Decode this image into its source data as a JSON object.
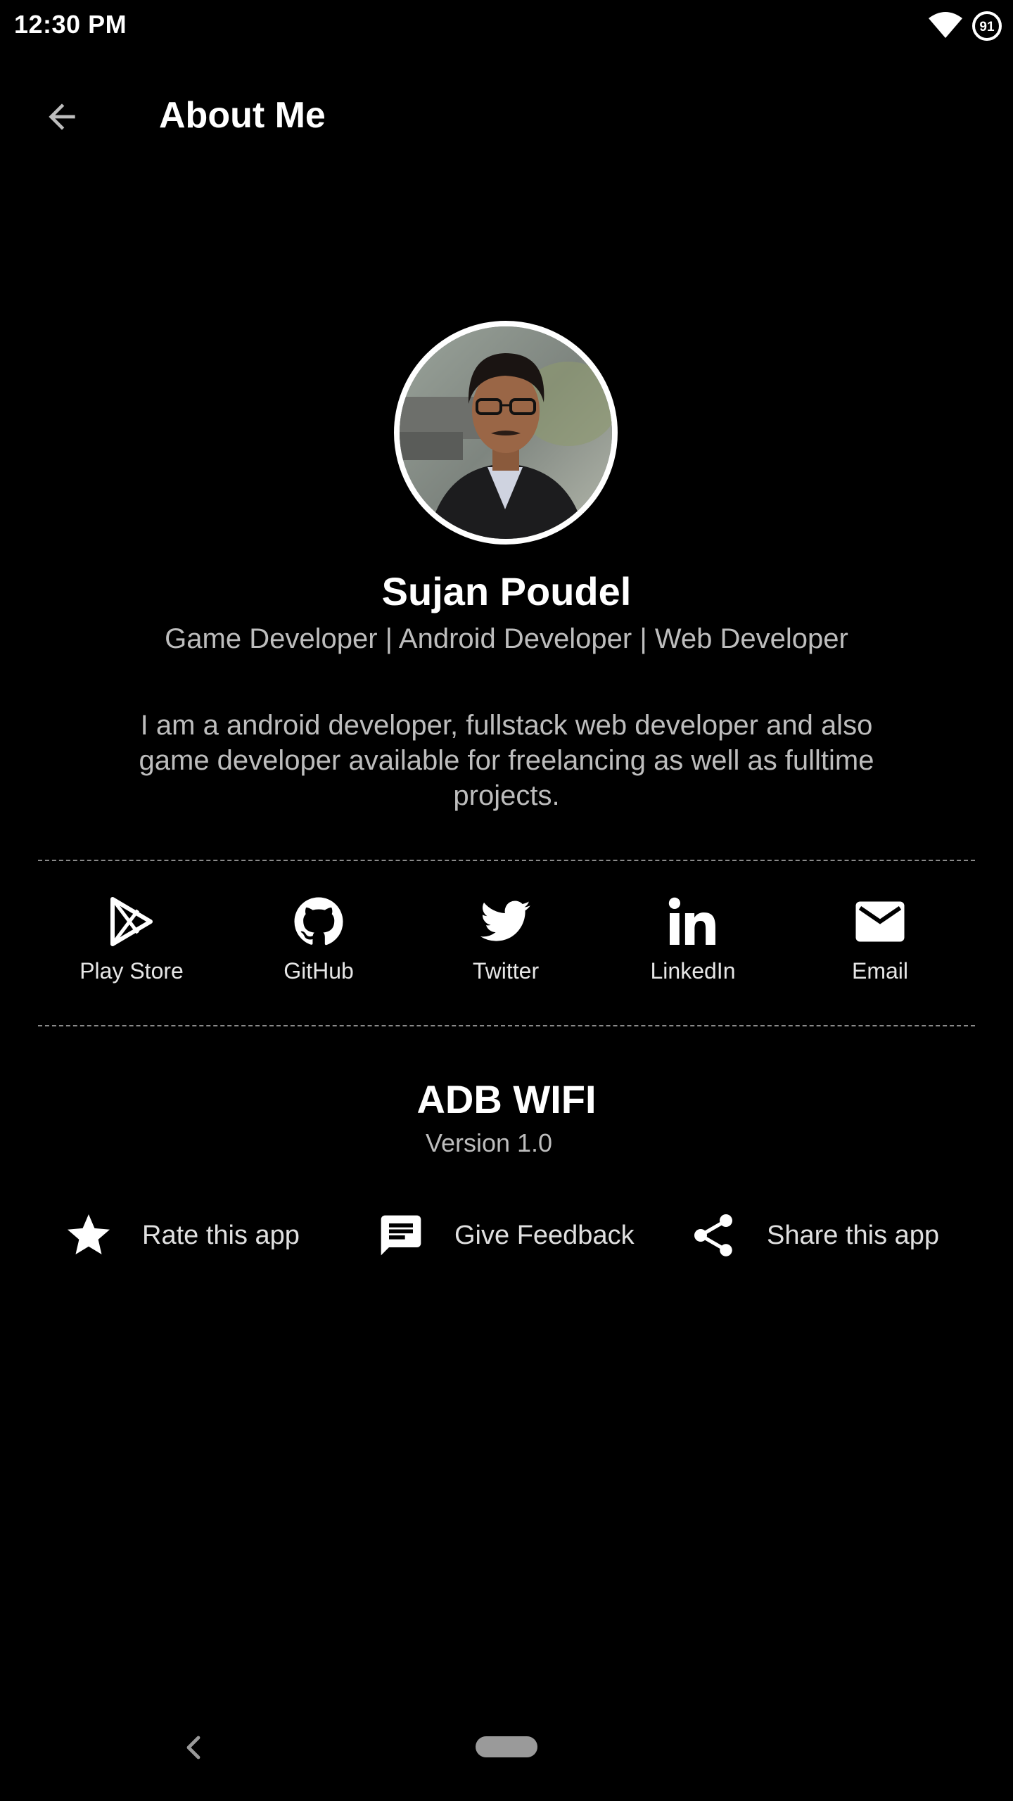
{
  "status_bar": {
    "time": "12:30 PM",
    "battery_level": "91"
  },
  "app_bar": {
    "title": "About Me"
  },
  "profile": {
    "name": "Sujan Poudel",
    "roles": "Game Developer | Android Developer | Web Developer",
    "bio": "I am a android developer, fullstack web developer and also game developer available for freelancing as well as fulltime projects."
  },
  "social_links": [
    {
      "label": "Play Store",
      "icon": "play-store-icon"
    },
    {
      "label": "GitHub",
      "icon": "github-icon"
    },
    {
      "label": "Twitter",
      "icon": "twitter-icon"
    },
    {
      "label": "LinkedIn",
      "icon": "linkedin-icon"
    },
    {
      "label": "Email",
      "icon": "email-icon"
    }
  ],
  "app_info": {
    "name": "ADB WIFI",
    "version": "Version 1.0"
  },
  "actions": [
    {
      "label": "Rate this app",
      "icon": "star-icon"
    },
    {
      "label": "Give Feedback",
      "icon": "feedback-icon"
    },
    {
      "label": "Share this app",
      "icon": "share-icon"
    }
  ],
  "colors": {
    "background": "#000000",
    "primary_text": "#ffffff",
    "secondary_text": "#bdbdbd",
    "divider": "#8a8a8a"
  }
}
